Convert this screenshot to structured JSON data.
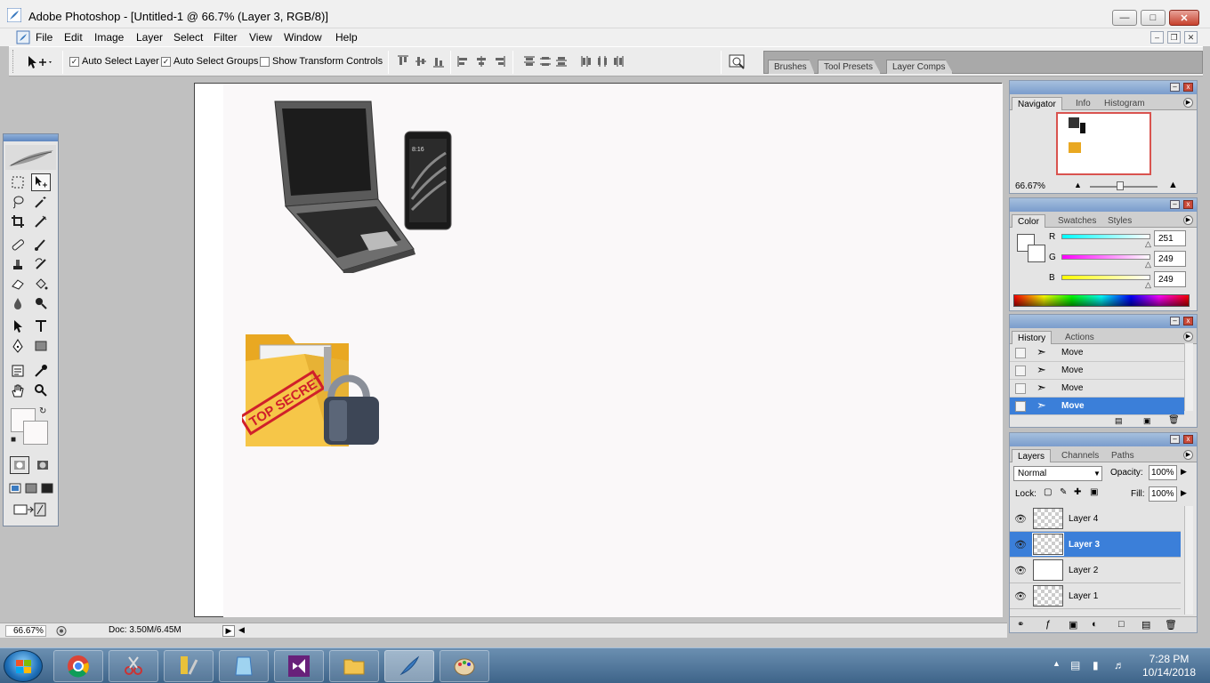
{
  "window": {
    "title": "Adobe Photoshop - [Untitled-1 @ 66.7% (Layer 3, RGB/8)]"
  },
  "menu": [
    "File",
    "Edit",
    "Image",
    "Layer",
    "Select",
    "Filter",
    "View",
    "Window",
    "Help"
  ],
  "options": {
    "auto_select_layer": {
      "label": "Auto Select Layer",
      "checked": true
    },
    "auto_select_groups": {
      "label": "Auto Select Groups",
      "checked": true
    },
    "show_transform_controls": {
      "label": "Show Transform Controls",
      "checked": false
    }
  },
  "palette_well": {
    "tabs": [
      "Brushes",
      "Tool Presets",
      "Layer Comps"
    ]
  },
  "canvas": {
    "image_laptop_text": "8:16",
    "folder_stamp": "TOP SECRET"
  },
  "status": {
    "zoom": "66.67%",
    "doc": "Doc: 3.50M/6.45M"
  },
  "navigator": {
    "tabs": [
      "Navigator",
      "Info",
      "Histogram"
    ],
    "zoom": "66.67%"
  },
  "color": {
    "tabs": [
      "Color",
      "Swatches",
      "Styles"
    ],
    "channels": [
      {
        "label": "R",
        "value": "251"
      },
      {
        "label": "G",
        "value": "249"
      },
      {
        "label": "B",
        "value": "249"
      }
    ]
  },
  "history": {
    "tabs": [
      "History",
      "Actions"
    ],
    "items": [
      "Move",
      "Move",
      "Move",
      "Move"
    ]
  },
  "layers": {
    "tabs": [
      "Layers",
      "Channels",
      "Paths"
    ],
    "blend_mode": "Normal",
    "opacity_label": "Opacity:",
    "opacity": "100%",
    "lock_label": "Lock:",
    "fill_label": "Fill:",
    "fill": "100%",
    "items": [
      "Layer 4",
      "Layer 3",
      "Layer 2",
      "Layer 1"
    ],
    "selected": "Layer 3"
  },
  "taskbar": {
    "time": "7:28 PM",
    "date": "10/14/2018"
  }
}
